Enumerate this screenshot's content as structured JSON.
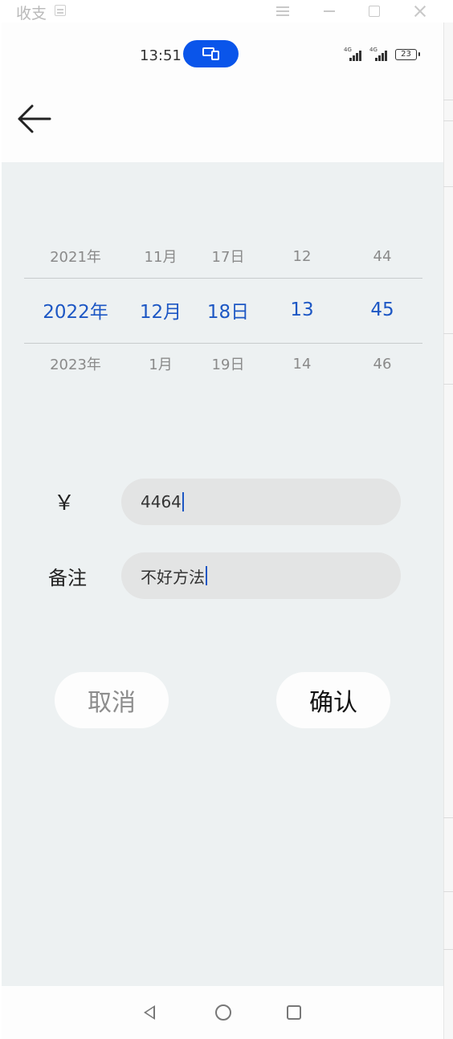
{
  "window": {
    "title": "收支",
    "icons": {
      "menu": "menu-icon",
      "minimize": "minimize-icon",
      "maximize": "maximize-icon",
      "close": "close-icon"
    }
  },
  "status_bar": {
    "time": "13:51",
    "network_1": "4G",
    "network_2": "4G",
    "battery": "23",
    "icons": [
      "screen-share-icon",
      "signal-icon",
      "battery-icon"
    ]
  },
  "app_bar": {
    "back_icon": "arrow-left-icon"
  },
  "picker": {
    "prev": {
      "year": "2021年",
      "month": "11月",
      "day": "17日",
      "hour": "12",
      "minute": "44"
    },
    "selected": {
      "year": "2022年",
      "month": "12月",
      "day": "18日",
      "hour": "13",
      "minute": "45"
    },
    "next": {
      "year": "2023年",
      "month": "1月",
      "day": "19日",
      "hour": "14",
      "minute": "46"
    }
  },
  "form": {
    "amount_label": "￥",
    "amount_value": "4464",
    "note_label": "备注",
    "note_value": "不好方法"
  },
  "buttons": {
    "cancel": "取消",
    "confirm": "确认"
  },
  "nav_bar": {
    "icons": [
      "nav-back-icon",
      "nav-home-icon",
      "nav-recent-icon"
    ]
  },
  "colors": {
    "accent_blue": "#1d57c4",
    "pill_blue": "#0a55ea",
    "background": "#edf1f2",
    "input_background": "#e3e4e4"
  }
}
